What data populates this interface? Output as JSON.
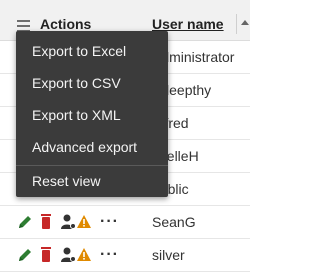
{
  "header": {
    "actions_label": "Actions",
    "username_label": "User name"
  },
  "rows": [
    {
      "user": "Administrator"
    },
    {
      "user": "Adeepthy"
    },
    {
      "user": "Alfred"
    },
    {
      "user": "JoelleH"
    },
    {
      "user": "public"
    },
    {
      "user": "SeanG"
    },
    {
      "user": "silver"
    }
  ],
  "menu": {
    "items": [
      "Export to Excel",
      "Export to CSV",
      "Export to XML",
      "Advanced export",
      "Reset view"
    ]
  },
  "colors": {
    "menu_bg": "#3b3b3b",
    "edit": "#2e7d32",
    "delete": "#c62828",
    "warning": "#e08a00"
  }
}
